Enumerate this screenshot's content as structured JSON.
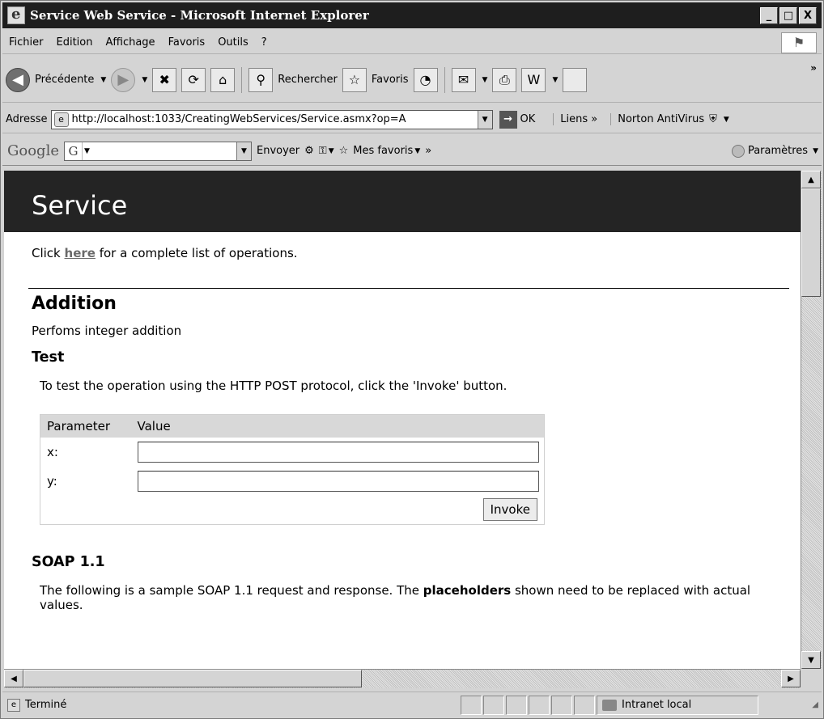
{
  "window": {
    "title": "Service Web Service - Microsoft Internet Explorer",
    "minimize_glyph": "_",
    "maximize_glyph": "□",
    "close_glyph": "X"
  },
  "menu": {
    "items": [
      "Fichier",
      "Edition",
      "Affichage",
      "Favoris",
      "Outils",
      "?"
    ]
  },
  "toolbar": {
    "back_label": "Précédente",
    "search_label": "Rechercher",
    "favorites_label": "Favoris",
    "more_glyph": "»"
  },
  "address": {
    "label": "Adresse",
    "url": "http://localhost:1033/CreatingWebServices/Service.asmx?op=A",
    "go_label": "OK",
    "links_label": "Liens »",
    "norton_label": "Norton AntiVirus"
  },
  "google": {
    "logo": "Google",
    "send_label": "Envoyer",
    "favorites_label": "Mes favoris",
    "more_glyph": "»",
    "settings_label": "Paramètres"
  },
  "page": {
    "banner_title": "Service",
    "intro_before": "Click ",
    "intro_link": "here",
    "intro_after": " for a complete list of operations.",
    "operation_title": "Addition",
    "operation_desc": "Perfoms integer addition",
    "test_heading": "Test",
    "test_desc": "To test the operation using the HTTP POST protocol, click the 'Invoke' button.",
    "table_headers": [
      "Parameter",
      "Value"
    ],
    "params": [
      {
        "name": "x:",
        "value": ""
      },
      {
        "name": "y:",
        "value": ""
      }
    ],
    "invoke_label": "Invoke",
    "soap_heading": "SOAP 1.1",
    "soap_desc_before": "The following is a sample SOAP 1.1 request and response. The ",
    "soap_desc_bold": "placeholders",
    "soap_desc_after": " shown need to be replaced with actual values."
  },
  "status": {
    "text": "Terminé",
    "zone": "Intranet local"
  },
  "colors": {
    "banner_bg": "#242424",
    "link": "#6a6a6a",
    "table_header_bg": "#d8d8d8"
  }
}
